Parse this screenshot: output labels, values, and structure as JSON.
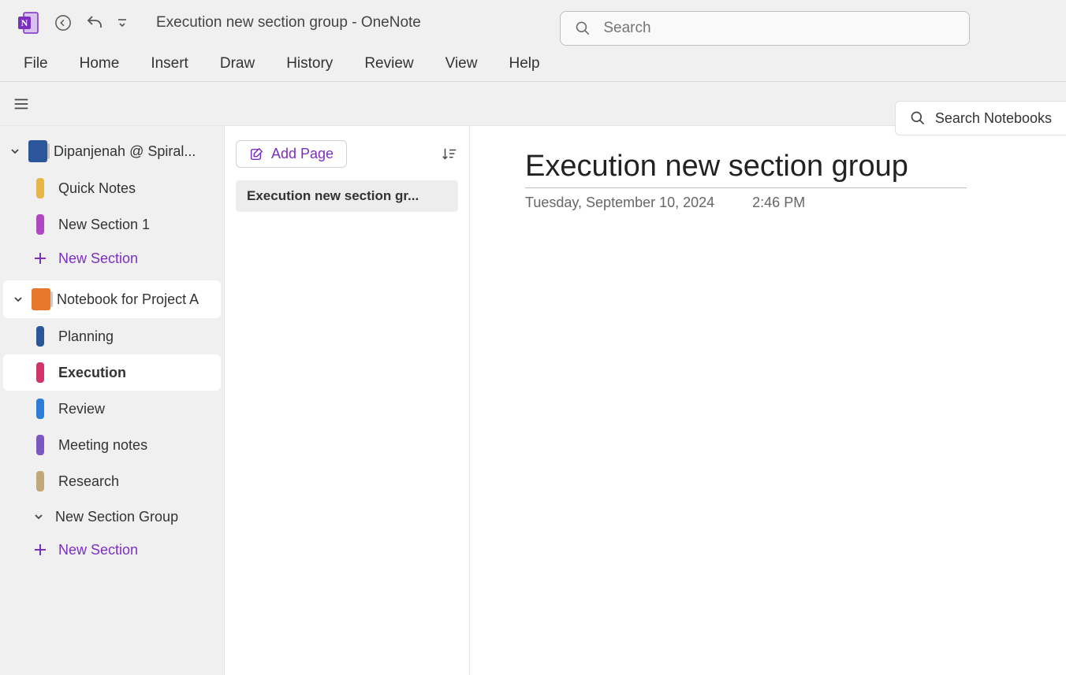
{
  "titlebar": {
    "document_title": "Execution new section group",
    "separator": "  -  ",
    "app_name": "OneNote"
  },
  "search": {
    "placeholder": "Search"
  },
  "ribbon": {
    "tabs": [
      "File",
      "Home",
      "Insert",
      "Draw",
      "History",
      "Review",
      "View",
      "Help"
    ]
  },
  "search_notebooks": {
    "label": "Search Notebooks"
  },
  "nav": {
    "notebooks": [
      {
        "name": "Dipanjenah @ Spiral...",
        "color": "#2b579a",
        "expanded": true,
        "selected": false,
        "sections": [
          {
            "name": "Quick Notes",
            "color": "#e8b647",
            "active": false
          },
          {
            "name": "New Section 1",
            "color": "#b146c2",
            "active": false
          }
        ],
        "new_section_label": "New Section"
      },
      {
        "name": "Notebook for Project A",
        "color": "#e8782b",
        "expanded": true,
        "selected": true,
        "sections": [
          {
            "name": "Planning",
            "color": "#2b579a",
            "active": false
          },
          {
            "name": "Execution",
            "color": "#d13468",
            "active": true
          },
          {
            "name": "Review",
            "color": "#2e7cd6",
            "active": false
          },
          {
            "name": "Meeting notes",
            "color": "#7b57c2",
            "active": false
          },
          {
            "name": "Research",
            "color": "#c2a77b",
            "active": false
          }
        ],
        "groups": [
          {
            "name": "New Section Group"
          }
        ],
        "new_section_label": "New Section"
      }
    ]
  },
  "pages": {
    "add_label": "Add Page",
    "items": [
      {
        "title": "Execution new section gr..."
      }
    ]
  },
  "canvas": {
    "title": "Execution new section group",
    "date": "Tuesday, September 10, 2024",
    "time": "2:46 PM"
  }
}
